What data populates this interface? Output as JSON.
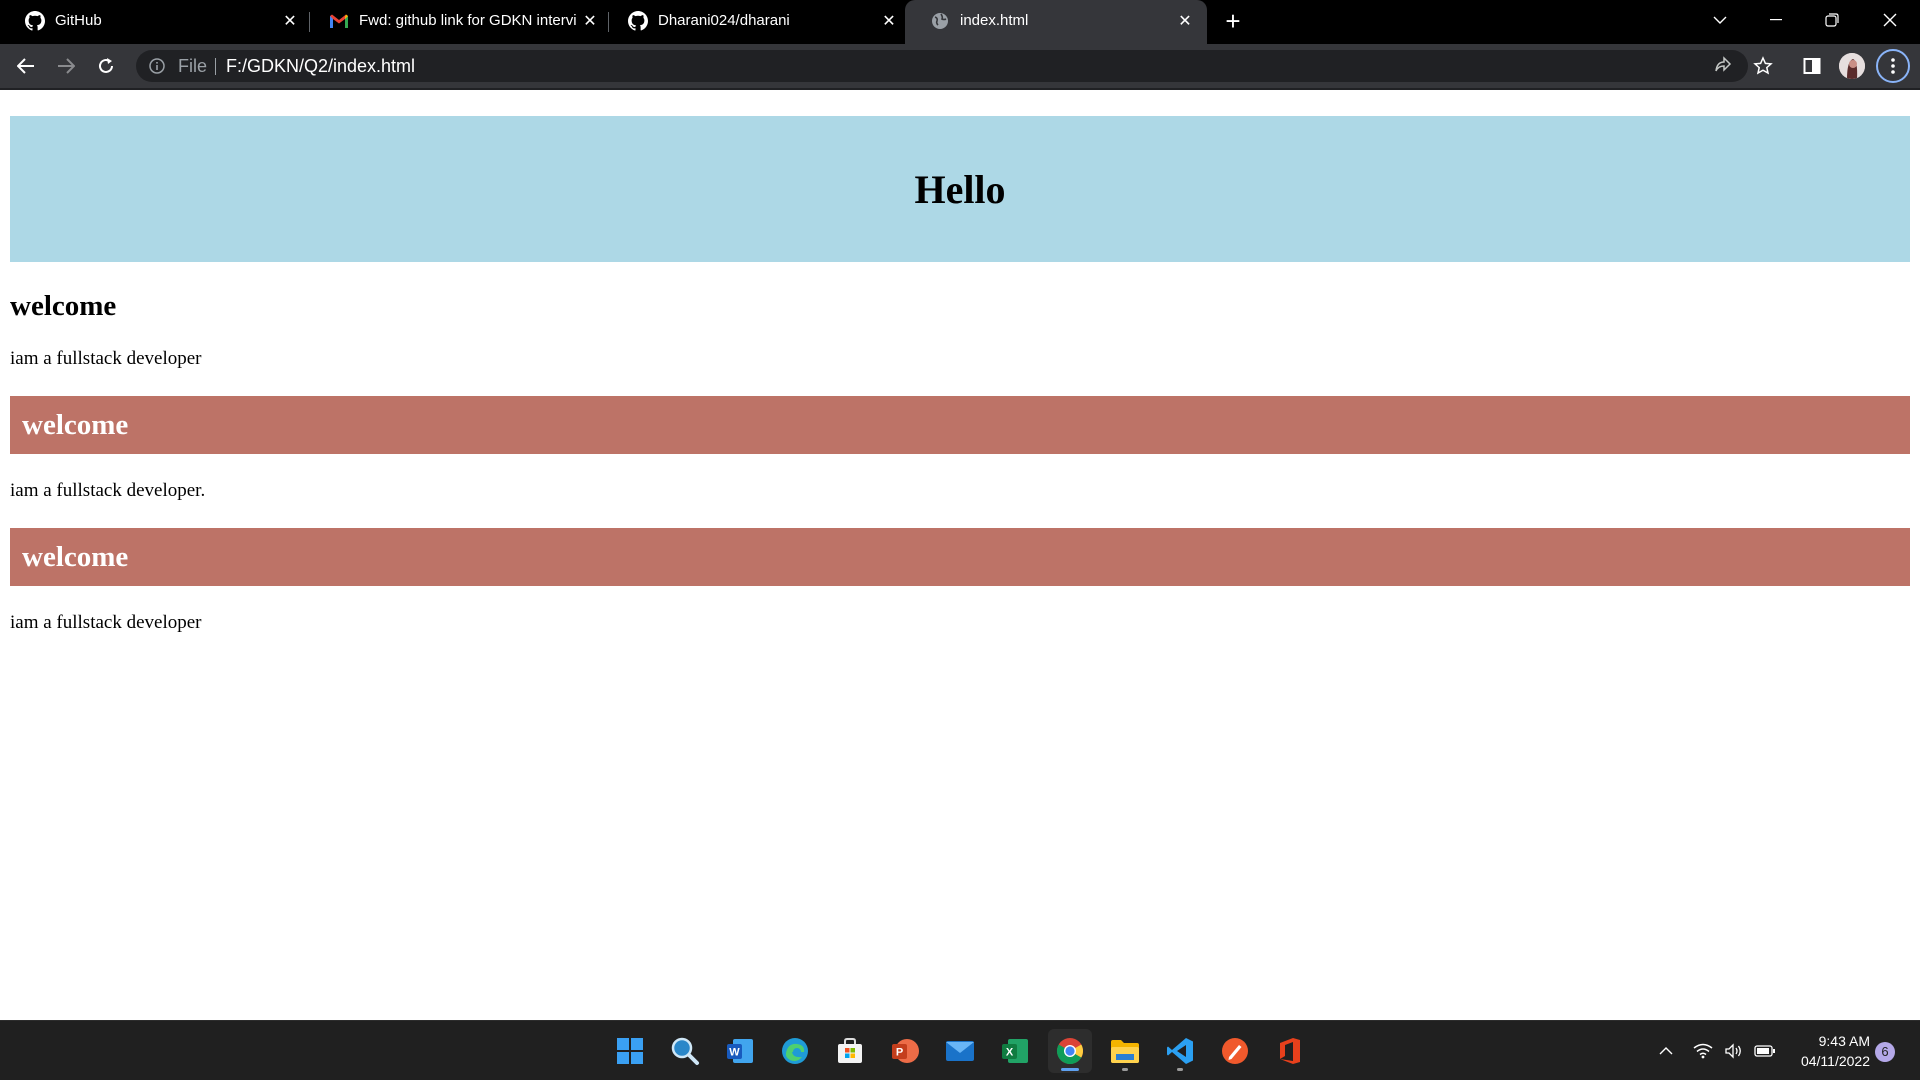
{
  "browser": {
    "tabs": [
      {
        "title": "GitHub",
        "icon": "github-icon"
      },
      {
        "title": "Fwd: github link for GDKN intervi",
        "icon": "gmail-icon"
      },
      {
        "title": "Dharani024/dharani",
        "icon": "github-icon"
      },
      {
        "title": "index.html",
        "icon": "globe-icon",
        "active": true
      }
    ],
    "address": {
      "scheme_label": "File",
      "url": "F:/GDKN/Q2/index.html"
    }
  },
  "page": {
    "hero_title": "Hello",
    "heading_1": "welcome",
    "para_1": "iam a fullstack developer",
    "band_1": "welcome",
    "para_2": "iam a fullstack developer.",
    "band_2": "welcome",
    "para_3": "iam a fullstack developer",
    "colors": {
      "hero_bg": "#add8e6",
      "band_bg": "#bd7367"
    }
  },
  "taskbar": {
    "apps": [
      "start",
      "search",
      "word",
      "edge",
      "store",
      "powerpoint",
      "mail",
      "excel",
      "chrome",
      "file-explorer",
      "vscode",
      "pen-app",
      "office"
    ],
    "clock": {
      "time": "9:43 AM",
      "date": "04/11/2022"
    },
    "notification_count": "6"
  }
}
